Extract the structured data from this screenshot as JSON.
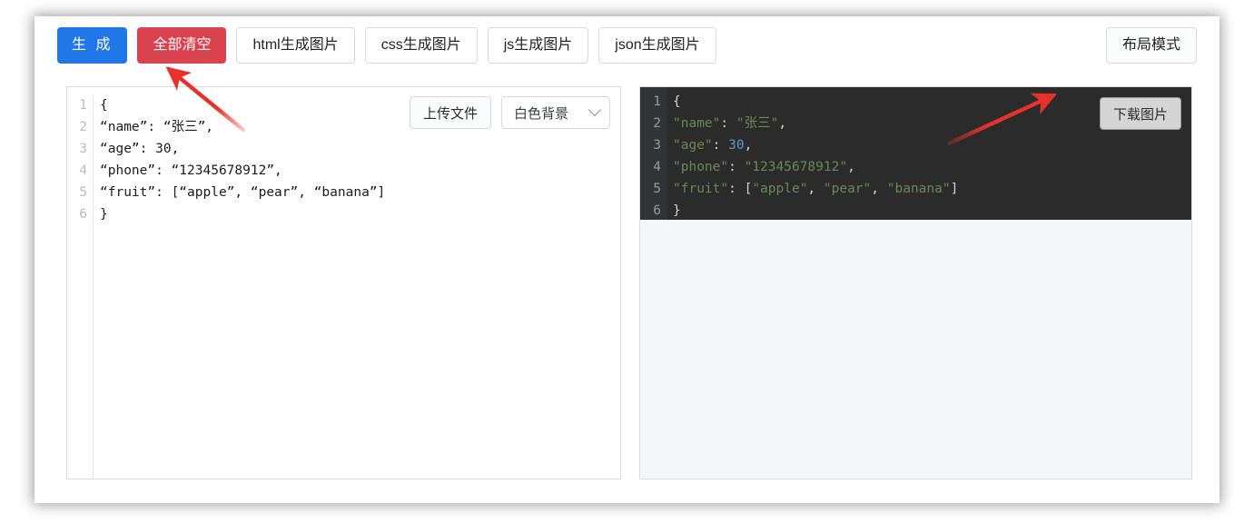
{
  "toolbar": {
    "generate_label": "生 成",
    "clear_all_label": "全部清空",
    "html_label": "html生成图片",
    "css_label": "css生成图片",
    "js_label": "js生成图片",
    "json_label": "json生成图片",
    "layout_mode_label": "布局模式"
  },
  "editor": {
    "line_numbers": [
      "1",
      "2",
      "3",
      "4",
      "5",
      "6"
    ],
    "code": "{\n“name”: “张三”,\n“age”: 30,\n“phone”: “12345678912”,\n“fruit”: [“apple”, “pear”, “banana”]\n}",
    "upload_label": "上传文件",
    "background_select_value": "白色背景",
    "background_select_options": [
      "白色背景"
    ]
  },
  "preview": {
    "download_label": "下载图片",
    "line_numbers": [
      "1",
      "2",
      "3",
      "4",
      "5",
      "6"
    ],
    "lines": [
      [
        {
          "t": "{",
          "c": "punc"
        }
      ],
      [
        {
          "t": "\"name\"",
          "c": "key"
        },
        {
          "t": ": ",
          "c": "punc"
        },
        {
          "t": "\"张三\"",
          "c": "str"
        },
        {
          "t": ",",
          "c": "punc"
        }
      ],
      [
        {
          "t": "\"age\"",
          "c": "key"
        },
        {
          "t": ": ",
          "c": "punc"
        },
        {
          "t": "30",
          "c": "num"
        },
        {
          "t": ",",
          "c": "punc"
        }
      ],
      [
        {
          "t": "\"phone\"",
          "c": "key"
        },
        {
          "t": ": ",
          "c": "punc"
        },
        {
          "t": "\"12345678912\"",
          "c": "str"
        },
        {
          "t": ",",
          "c": "punc"
        }
      ],
      [
        {
          "t": "\"fruit\"",
          "c": "key"
        },
        {
          "t": ": [",
          "c": "punc"
        },
        {
          "t": "\"apple\"",
          "c": "str"
        },
        {
          "t": ", ",
          "c": "punc"
        },
        {
          "t": "\"pear\"",
          "c": "str"
        },
        {
          "t": ", ",
          "c": "punc"
        },
        {
          "t": "\"banana\"",
          "c": "str"
        },
        {
          "t": "]",
          "c": "punc"
        }
      ],
      [
        {
          "t": "}",
          "c": "punc"
        }
      ]
    ]
  },
  "annotations": {
    "arrow_color": "#e8312a",
    "arrow_1_target": "全部清空",
    "arrow_2_target": "下载图片"
  },
  "colors": {
    "primary": "#2176e8",
    "danger": "#d9434f",
    "code_background": "#2b2b2b",
    "code_gutter": "#313335",
    "string_green": "#6a8759",
    "number_blue": "#6897bb",
    "panel_background": "#f5f6f8"
  }
}
